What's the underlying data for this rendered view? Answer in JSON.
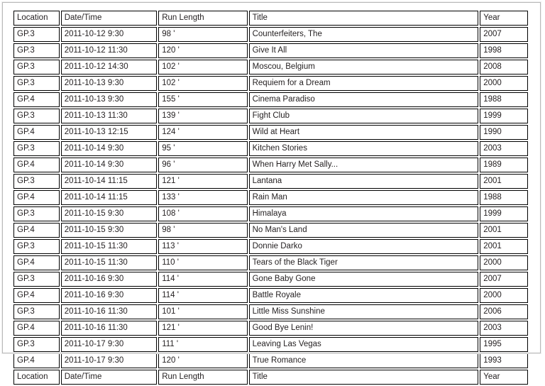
{
  "table": {
    "columns": [
      {
        "key": "location",
        "label": "Location"
      },
      {
        "key": "datetime",
        "label": "Date/Time"
      },
      {
        "key": "run_length",
        "label": "Run Length"
      },
      {
        "key": "title",
        "label": "Title"
      },
      {
        "key": "year",
        "label": "Year"
      }
    ],
    "header": {
      "location": "Location",
      "datetime": "Date/Time",
      "run_length": "Run Length",
      "title": "Title",
      "year": "Year"
    },
    "footer": {
      "location": "Location",
      "datetime": "Date/Time",
      "run_length": "Run Length",
      "title": "Title",
      "year": "Year"
    },
    "rows": [
      {
        "location": "GP.3",
        "datetime": "2011-10-12 9:30",
        "run_length": "98 '",
        "title": "Counterfeiters, The",
        "year": "2007"
      },
      {
        "location": "GP.3",
        "datetime": "2011-10-12 11:30",
        "run_length": "120 '",
        "title": "Give It All",
        "year": "1998"
      },
      {
        "location": "GP.3",
        "datetime": "2011-10-12 14:30",
        "run_length": "102 '",
        "title": "Moscou, Belgium",
        "year": "2008"
      },
      {
        "location": "GP.3",
        "datetime": "2011-10-13 9:30",
        "run_length": "102 '",
        "title": "Requiem for a Dream",
        "year": "2000"
      },
      {
        "location": "GP.4",
        "datetime": "2011-10-13 9:30",
        "run_length": "155 '",
        "title": "Cinema Paradiso",
        "year": "1988"
      },
      {
        "location": "GP.3",
        "datetime": "2011-10-13 11:30",
        "run_length": "139 '",
        "title": "Fight Club",
        "year": "1999"
      },
      {
        "location": "GP.4",
        "datetime": "2011-10-13 12:15",
        "run_length": "124 '",
        "title": "Wild at Heart",
        "year": "1990"
      },
      {
        "location": "GP.3",
        "datetime": "2011-10-14 9:30",
        "run_length": "95 '",
        "title": "Kitchen Stories",
        "year": "2003"
      },
      {
        "location": "GP.4",
        "datetime": "2011-10-14 9:30",
        "run_length": "96 '",
        "title": "When Harry Met Sally...",
        "year": "1989"
      },
      {
        "location": "GP.3",
        "datetime": "2011-10-14 11:15",
        "run_length": "121 '",
        "title": "Lantana",
        "year": "2001"
      },
      {
        "location": "GP.4",
        "datetime": "2011-10-14 11:15",
        "run_length": "133 '",
        "title": "Rain Man",
        "year": "1988"
      },
      {
        "location": "GP.3",
        "datetime": "2011-10-15 9:30",
        "run_length": "108 '",
        "title": "Himalaya",
        "year": "1999"
      },
      {
        "location": "GP.4",
        "datetime": "2011-10-15 9:30",
        "run_length": "98 '",
        "title": "No Man's Land",
        "year": "2001"
      },
      {
        "location": "GP.3",
        "datetime": "2011-10-15 11:30",
        "run_length": "113 '",
        "title": "Donnie Darko",
        "year": "2001"
      },
      {
        "location": "GP.4",
        "datetime": "2011-10-15 11:30",
        "run_length": "110 '",
        "title": "Tears of the Black Tiger",
        "year": "2000"
      },
      {
        "location": "GP.3",
        "datetime": "2011-10-16 9:30",
        "run_length": "114 '",
        "title": "Gone Baby Gone",
        "year": "2007"
      },
      {
        "location": "GP.4",
        "datetime": "2011-10-16 9:30",
        "run_length": "114 '",
        "title": "Battle Royale",
        "year": "2000"
      },
      {
        "location": "GP.3",
        "datetime": "2011-10-16 11:30",
        "run_length": "101 '",
        "title": "Little Miss Sunshine",
        "year": "2006"
      },
      {
        "location": "GP.4",
        "datetime": "2011-10-16 11:30",
        "run_length": "121 '",
        "title": "Good Bye Lenin!",
        "year": "2003"
      },
      {
        "location": "GP.3",
        "datetime": "2011-10-17 9:30",
        "run_length": "111 '",
        "title": "Leaving Las Vegas",
        "year": "1995"
      },
      {
        "location": "GP.4",
        "datetime": "2011-10-17 9:30",
        "run_length": "120 '",
        "title": "True Romance",
        "year": "1993"
      }
    ]
  }
}
